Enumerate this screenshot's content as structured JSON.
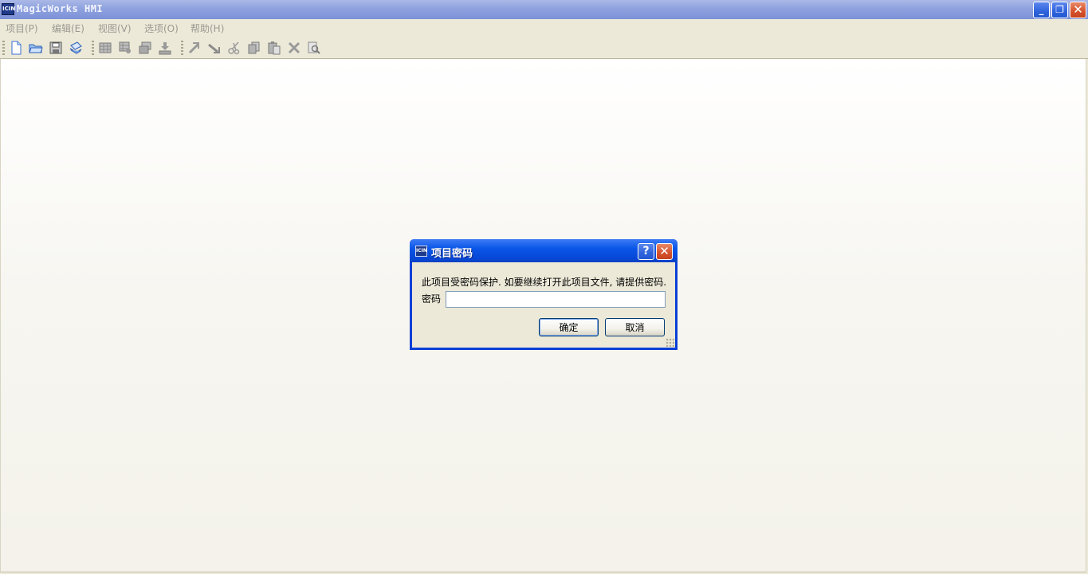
{
  "window": {
    "title": "MagicWorks HMI",
    "icon_text": "ICIN",
    "icon": "app-icon",
    "controls": {
      "minimize": "minimize-icon",
      "restore": "restore-icon",
      "close": "close-icon"
    }
  },
  "menu": {
    "items": [
      {
        "label": "项目(P)"
      },
      {
        "label": "编辑(E)"
      },
      {
        "label": "视图(V)"
      },
      {
        "label": "选项(O)"
      },
      {
        "label": "帮助(H)"
      }
    ],
    "text_color": "#9b9a92"
  },
  "toolbar": {
    "groups": [
      [
        "new-file-icon",
        "open-folder-icon",
        "save-icon",
        "print-icon"
      ],
      [
        "grid-icon",
        "grid-config-icon",
        "compile-icon",
        "download-icon"
      ],
      [
        "undo-icon",
        "redo-icon",
        "cut-icon",
        "copy-icon",
        "paste-icon",
        "delete-icon",
        "find-icon"
      ]
    ]
  },
  "dialog": {
    "title": "项目密码",
    "message": "此项目受密码保护. 如要继续打开此项目文件, 请提供密码.",
    "password_label": "密码",
    "password_value": "",
    "ok_label": "确定",
    "cancel_label": "取消",
    "help_glyph": "?",
    "close_glyph": "✕"
  },
  "colors": {
    "title_bar": "#8fa2df",
    "dialog_title": "#0b56e8",
    "face": "#ece9d8"
  }
}
